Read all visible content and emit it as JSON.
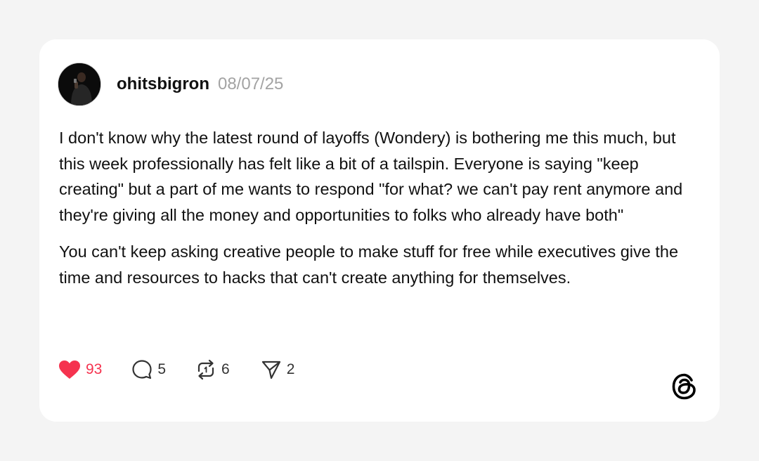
{
  "post": {
    "username": "ohitsbigron",
    "date": "08/07/25",
    "paragraphs": [
      "I don't know why the latest round of layoffs (Wondery) is bothering me this much, but this week professionally has felt like a bit of a tailspin. Everyone is saying \"keep creating\" but a part of me wants to respond \"for what? we can't pay rent anymore and they're giving all the money and opportunities to folks who already have both\"",
      "You can't keep asking creative people to make stuff for free while executives give the time and resources to hacks that can't create anything for themselves."
    ]
  },
  "actions": {
    "likes": "93",
    "comments": "5",
    "reposts": "6",
    "shares": "2"
  },
  "icons": {
    "like": "heart-filled-icon",
    "comment": "comment-bubble-icon",
    "repost": "repost-icon",
    "share": "send-icon",
    "brand": "threads-logo-icon"
  },
  "colors": {
    "like_active": "#f5334f",
    "date_gray": "#a3a3a3",
    "background": "#f4f4f4",
    "card": "#ffffff"
  }
}
